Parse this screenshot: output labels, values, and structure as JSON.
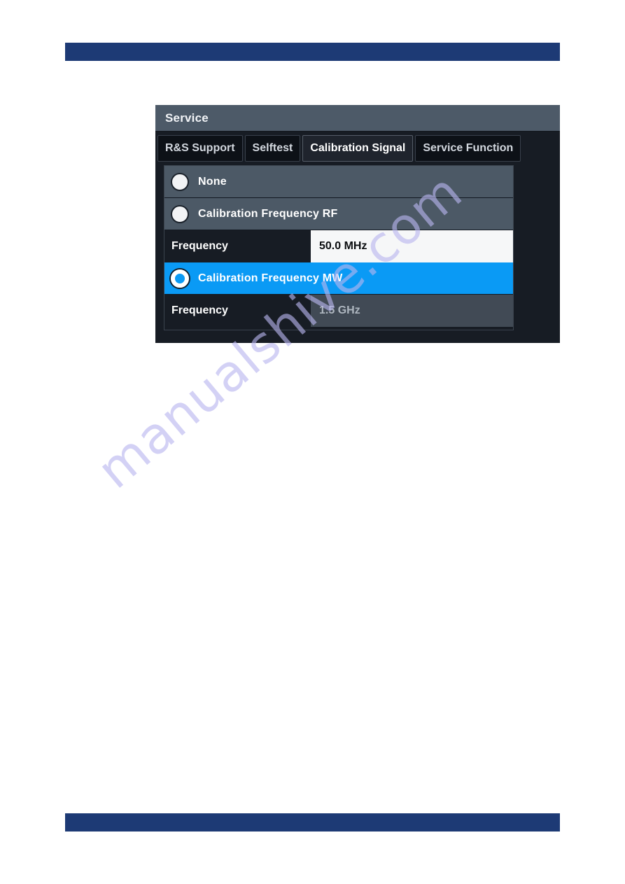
{
  "page": {
    "header_rule_color": "#1d3a75",
    "footer_rule_color": "#1d3a75",
    "watermark": "manualshive.com"
  },
  "dialog": {
    "title": "Service",
    "tabs": [
      {
        "label": "R&S Support",
        "active": false
      },
      {
        "label": "Selftest",
        "active": false
      },
      {
        "label": "Calibration Signal",
        "active": true
      },
      {
        "label": "Service Function",
        "active": false
      }
    ],
    "accent_color": "#0a9af5",
    "options": [
      {
        "label": "None",
        "selected": false
      },
      {
        "label": "Calibration Frequency RF",
        "selected": false
      },
      {
        "label": "Calibration Frequency MW",
        "selected": true
      }
    ],
    "fields": [
      {
        "label": "Frequency",
        "value": "50.0 MHz",
        "state": "editable"
      },
      {
        "label": "Frequency",
        "value": "1.5 GHz",
        "state": "disabled"
      }
    ]
  }
}
